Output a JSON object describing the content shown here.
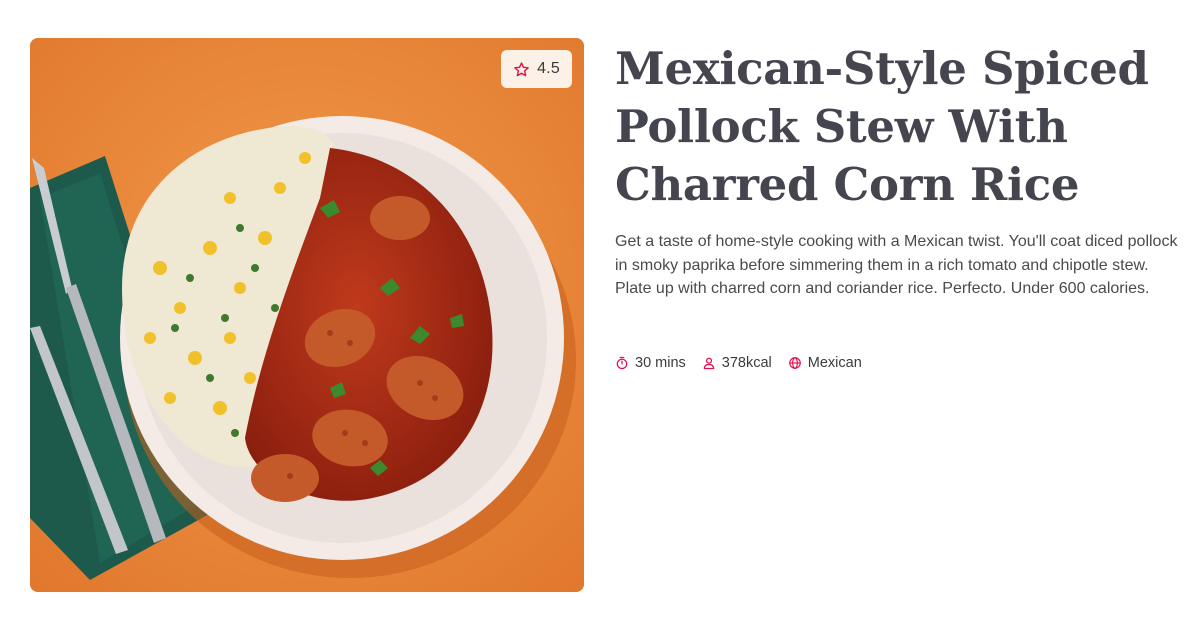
{
  "recipe": {
    "title": "Mexican-Style Spiced Pollock Stew With Charred Corn Rice",
    "description": "Get a taste of home-style cooking with a Mexican twist. You'll coat diced pollock in smoky paprika before simmering them in a rich tomato and chipotle stew. Plate up with charred corn and coriander rice. Perfecto. Under 600 calories.",
    "rating": "4.5",
    "rating_icon": "star-icon",
    "meta": {
      "time": "30 mins",
      "time_icon": "timer-icon",
      "calories": "378kcal",
      "calories_icon": "person-icon",
      "cuisine": "Mexican",
      "cuisine_icon": "globe-icon"
    }
  },
  "colors": {
    "accent": "#e5104e",
    "title": "#454550",
    "body_text": "#4a4a4a",
    "photo_background": "#ec8a3c",
    "badge_background": "#fbf1e6"
  }
}
